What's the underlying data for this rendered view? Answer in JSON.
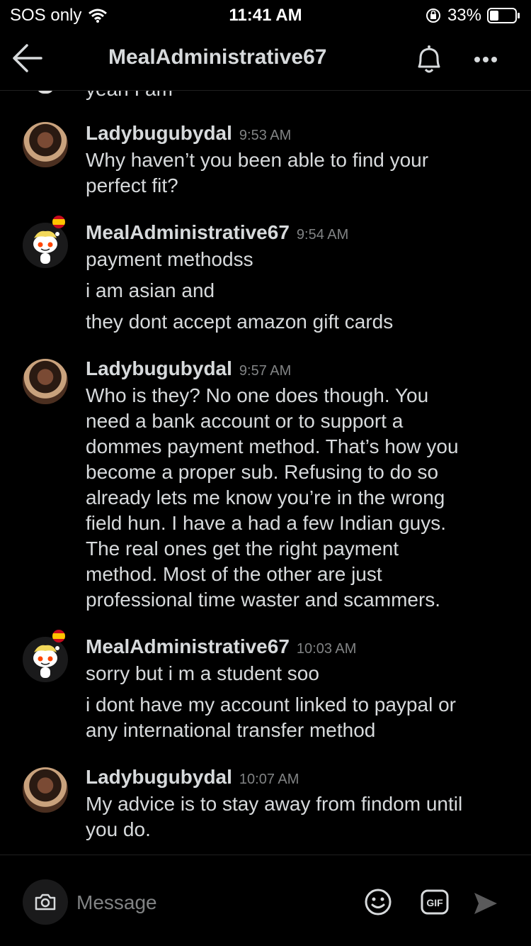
{
  "status": {
    "carrier": "SOS only",
    "time": "11:41 AM",
    "battery": "33%"
  },
  "header": {
    "title": "MealAdministrative67"
  },
  "cutoff_text": "yeah I am",
  "messages": [
    {
      "author": "Ladybugubydal",
      "time": "9:53 AM",
      "avatar": "user-photo",
      "lines": [
        "Why haven’t you been able to find your",
        "perfect fit?"
      ]
    },
    {
      "author": "MealAdministrative67",
      "time": "9:54 AM",
      "avatar": "snoo",
      "paragraphs": [
        "payment methodss",
        "i am asian and",
        "they dont accept amazon gift cards"
      ]
    },
    {
      "author": "Ladybugubydal",
      "time": "9:57 AM",
      "avatar": "user-photo",
      "lines": [
        "Who is they? No one does though. You",
        "need a bank account or to support a",
        "dommes payment method. That’s how you",
        "become a proper sub. Refusing to do so",
        "already lets me know you’re in the wrong",
        "field hun. I have a had a few Indian guys.",
        "The real ones get the right payment",
        "method. Most of the other are just",
        "professional time waster and scammers."
      ]
    },
    {
      "author": "MealAdministrative67",
      "time": "10:03 AM",
      "avatar": "snoo",
      "paragraphs": [
        "sorry but i m a student soo",
        "i dont have my account linked to paypal or\nany international transfer method"
      ]
    },
    {
      "author": "Ladybugubydal",
      "time": "10:07 AM",
      "avatar": "user-photo",
      "lines": [
        "My advice is to stay away from findom until",
        "you do."
      ]
    }
  ],
  "composer": {
    "placeholder": "Message",
    "gif_label": "GIF"
  },
  "colors": {
    "background": "#000000",
    "text": "#d7dadc",
    "muted": "#818384"
  }
}
